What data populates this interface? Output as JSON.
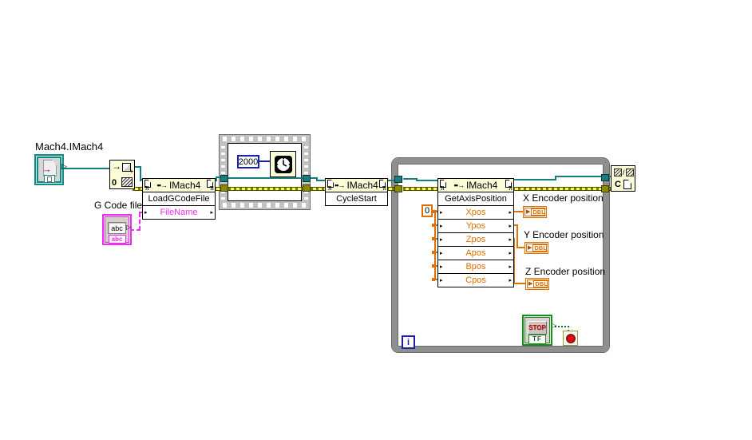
{
  "nodes": {
    "refnum": {
      "label": "Mach4.IMach4"
    },
    "automation_open": {
      "zero": "0"
    },
    "invoke_load": {
      "title": "IMach4",
      "method": "LoadGCodeFile",
      "params": [
        "FileName"
      ]
    },
    "gcode_control": {
      "label": "G Code file",
      "value": "abc",
      "type_tab": "abc"
    },
    "sequence": {
      "wait_constant": "2000"
    },
    "invoke_cycle": {
      "title": "IMach4",
      "method": "CycleStart"
    },
    "invoke_axis": {
      "title": "IMach4",
      "method": "GetAxisPosition",
      "axis_constant": "0",
      "params": [
        "Xpos",
        "Ypos",
        "Zpos",
        "Apos",
        "Bpos",
        "Cpos"
      ]
    },
    "indicators": [
      {
        "label": "X Encoder position",
        "type": "DBL"
      },
      {
        "label": "Y Encoder position",
        "type": "DBL"
      },
      {
        "label": "Z Encoder position",
        "type": "DBL"
      }
    ],
    "stop_button": {
      "label": "STOP",
      "boolean_label": "TF"
    },
    "loop": {
      "iteration_label": "i"
    },
    "close_reference": {
      "label": "C"
    }
  },
  "icons": {
    "invoke_arrow": "••→",
    "error_glyph": "?!",
    "output_arrow": "▷",
    "param_arrow": "▸",
    "open_arrow": "→",
    "refnum_arrow": "→",
    "slash": "/",
    "plus": "+"
  },
  "colors": {
    "refnum_teal": "#0f8c84",
    "wire_teal": "#147f7f",
    "error_olive": "#8a8a00",
    "numeric_orange": "#e07000",
    "string_magenta": "#f02bf0",
    "int_blue": "#1622b7",
    "loop_gray": "#8f8f8f",
    "stop_green": "#1d8a1d",
    "stop_red": "#d40000",
    "node_yellow": "#fbfbd7"
  }
}
